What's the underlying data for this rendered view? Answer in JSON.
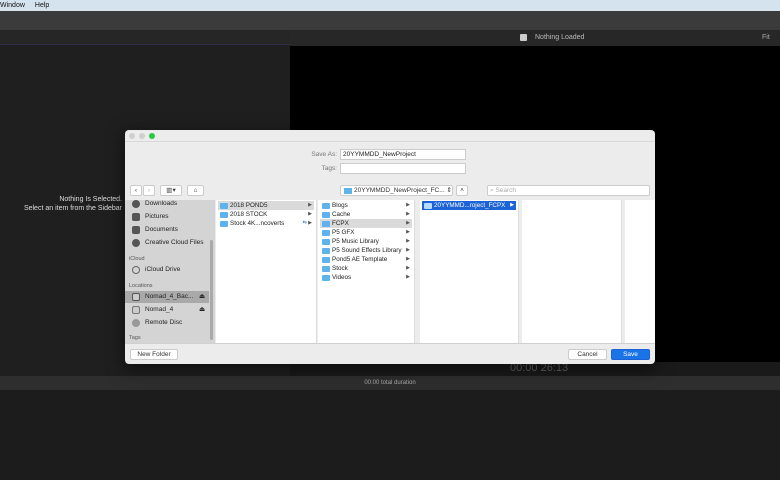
{
  "menubar": {
    "items": [
      "Window",
      "Help"
    ]
  },
  "viewer": {
    "status": "Nothing Loaded",
    "fit_label": "Fit",
    "timecode": "00:00 26:13"
  },
  "inspector": {
    "line1": "Nothing Is Selected.",
    "line2": "Select an item from the Sidebar"
  },
  "timeline": {
    "duration": "00:00 total duration"
  },
  "dialog": {
    "save_as_label": "Save As:",
    "save_as_value": "20YYMMDD_NewProject",
    "tags_label": "Tags:",
    "tags_value": "",
    "path_popup": "20YYMMDD_NewProject_FC...",
    "search_placeholder": "Search",
    "sidebar": {
      "favorites": [
        "Downloads",
        "Pictures",
        "Documents",
        "Creative Cloud Files"
      ],
      "icloud_header": "iCloud",
      "icloud": [
        "iCloud Drive"
      ],
      "locations_header": "Locations",
      "locations": [
        "Nomad_4_Bac...",
        "Nomad_4",
        "Remote Disc"
      ],
      "tags_header": "Tags"
    },
    "columns": [
      [
        "2018 POND5",
        "2018 STOCK",
        "Stock 4K...ncoverts"
      ],
      [
        "Blogs",
        "Cache",
        "FCPX",
        "P5 GFX",
        "P5 Music Library",
        "P5 Sound Effects Library",
        "Pond5 AE Template",
        "Stock",
        "Videos"
      ],
      [
        "20YYMMD...roject_FCPX"
      ]
    ],
    "new_folder": "New Folder",
    "cancel": "Cancel",
    "save": "Save",
    "accent": "#1b63d6"
  }
}
